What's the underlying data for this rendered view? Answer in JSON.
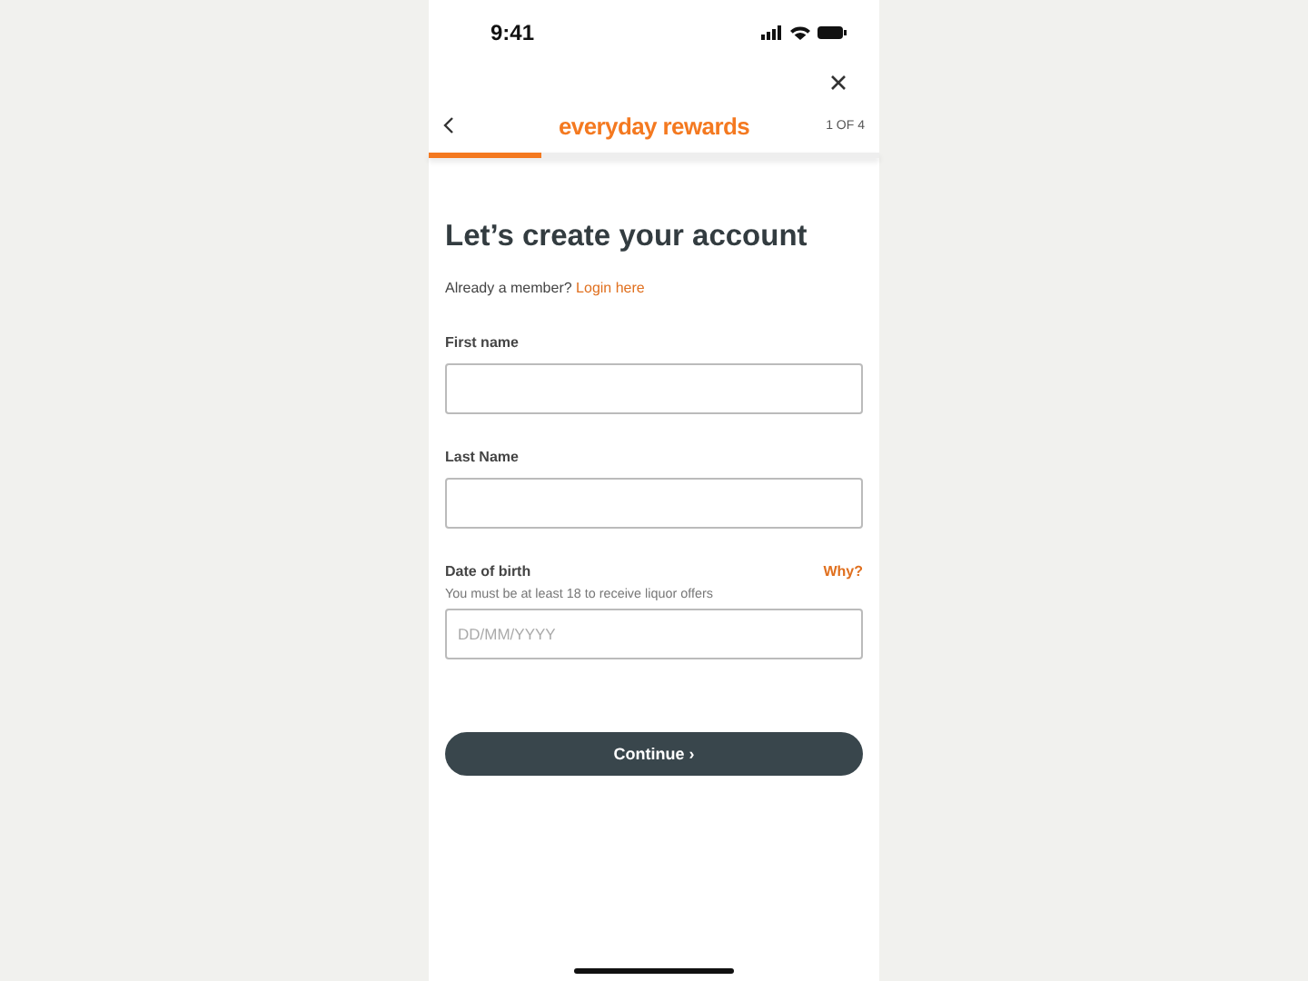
{
  "status_bar": {
    "time": "9:41"
  },
  "header": {
    "brand": "everyday rewards",
    "step": "1 OF 4",
    "progress": {
      "level": 0.25
    }
  },
  "title": "Let’s create your account",
  "login_prompt": {
    "text": "Already a member?",
    "link": "Login here"
  },
  "fields": [
    {
      "kind": "text",
      "label": "First name"
    },
    {
      "kind": "text",
      "label": "Last Name"
    },
    {
      "kind": "date",
      "label": "Date of birth",
      "link": "Why?",
      "hint": "You must be at least 18 to receive liquor offers",
      "placeholder": "DD/MM/YYYY"
    }
  ],
  "continue_button": {
    "label": "Continue",
    "arrow": "›"
  }
}
